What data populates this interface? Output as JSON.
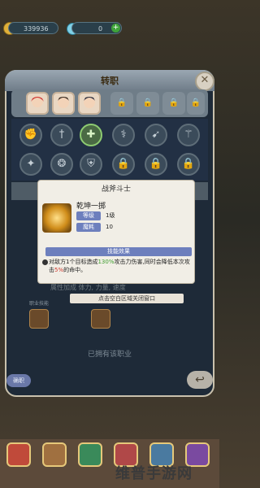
{
  "top_bar": {
    "gold": "339936",
    "gems": "0"
  },
  "panel": {
    "title": "转职",
    "owned_text": "已拥有该职业",
    "left_button_label": "确职"
  },
  "tabs": [
    {
      "type": "avatar",
      "name": "char-1"
    },
    {
      "type": "avatar",
      "name": "char-2"
    },
    {
      "type": "avatar",
      "name": "char-3"
    },
    {
      "type": "lock"
    },
    {
      "type": "lock"
    },
    {
      "type": "lock"
    },
    {
      "type": "lock"
    }
  ],
  "skills_row1": [
    "fist-icon",
    "sword-icon",
    "cross-icon",
    "staff-icon",
    "bow-icon",
    "wand-icon"
  ],
  "skills_row2": [
    "shuriken-icon",
    "ring-icon",
    "shield-icon",
    "lock-icon",
    "lock-icon",
    "lock-icon"
  ],
  "popup": {
    "header": "战斧斗士",
    "skill_name": "乾坤一掷",
    "level_label": "等级",
    "level_value": "1级",
    "mana_label": "魔耗",
    "mana_value": "10",
    "effect_title": "技能效果",
    "effect_text_1": "对敌方1个目标造成",
    "effect_highlight_green": "130%",
    "effect_text_2": "攻击力伤害,同时会降低本次攻击",
    "effect_highlight_red": "5%",
    "effect_text_3": "的命中。"
  },
  "dim_texts": {
    "line1": "属性加成    体力, 力量, 速度",
    "close_hint": "点击空白区域关闭窗口",
    "sub_label": "职业技能"
  },
  "watermark": "维普手游网",
  "colors": {
    "panel_bg": "#1e2a38",
    "popup_bg": "#f1eee6",
    "tag_bg": "#6d7fbd",
    "highlight_green": "#3f9e2f",
    "highlight_red": "#d03a2e"
  }
}
